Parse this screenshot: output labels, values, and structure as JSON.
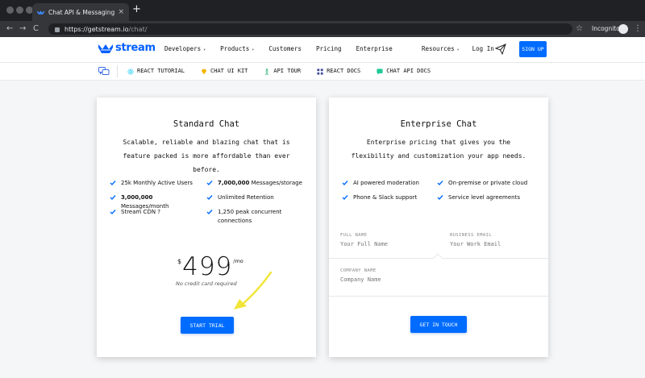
{
  "browser": {
    "tab_title": "Chat API & Messaging UI Kit",
    "tab_close": "×",
    "new_tab": "+",
    "url_host": "https://getstream.io",
    "url_path": "/chat/",
    "profile_label": "Incognito",
    "back": "←",
    "forward": "→",
    "reload": "C",
    "star": "☆",
    "menu": "⋮"
  },
  "header": {
    "logo_text": "stream",
    "nav": [
      {
        "label": "Developers",
        "caret": "▾"
      },
      {
        "label": "Products",
        "caret": "▾"
      },
      {
        "label": "Customers"
      },
      {
        "label": "Pricing"
      },
      {
        "label": "Enterprise"
      }
    ],
    "right_nav": [
      {
        "label": "Resources",
        "caret": "▾"
      },
      {
        "label": "Log In"
      }
    ],
    "signup_label": "SIGN UP",
    "brand_color": "#006cff"
  },
  "subnav": {
    "links": [
      {
        "label": "REACT TUTORIAL",
        "icon": "react-icon",
        "color": "#61dafb"
      },
      {
        "label": "CHAT UI KIT",
        "icon": "diamond-icon",
        "color": "#f5b400"
      },
      {
        "label": "API TOUR",
        "icon": "person-icon",
        "color": "#2bb673"
      },
      {
        "label": "REACT DOCS",
        "icon": "grid-icon",
        "color": "#3b4a9a"
      },
      {
        "label": "CHAT API DOCS",
        "icon": "chat-icon",
        "color": "#20c997"
      }
    ]
  },
  "standard": {
    "title": "Standard Chat",
    "description": "Scalable, reliable and blazing chat that is feature packed is more affordable than ever before.",
    "features_left": [
      {
        "bold": "",
        "text": "25k Monthly Active Users"
      },
      {
        "bold": "3,000,000",
        "text": " Messages/month"
      },
      {
        "bold": "",
        "text": "Stream CDN ?"
      }
    ],
    "features_right": [
      {
        "bold": "7,000,000",
        "text": " Messages/storage"
      },
      {
        "bold": "",
        "text": "Unlimited Retention"
      },
      {
        "bold": "",
        "text": "1,250 peak concurrent connections"
      }
    ],
    "currency": "$",
    "price": "499",
    "period": "/mo",
    "note": "No credit card required",
    "cta": "START TRIAL"
  },
  "enterprise": {
    "title": "Enterprise Chat",
    "description": "Enterprise pricing that gives you the flexibility and customization your app needs.",
    "features_left": [
      {
        "text": "AI powered moderation"
      },
      {
        "text": "Phone & Slack support"
      }
    ],
    "features_right": [
      {
        "text": "On-premise or private cloud"
      },
      {
        "text": "Service level agreements"
      }
    ],
    "form": {
      "full_name_label": "FULL NAME",
      "full_name_placeholder": "Your Full Name",
      "email_label": "BUSINESS EMAIL",
      "email_placeholder": "Your Work Email",
      "company_label": "COMPANY NAME",
      "company_placeholder": "Company Name"
    },
    "cta": "GET IN TOUCH"
  },
  "colors": {
    "check": "#006cff",
    "arrow": "#f2e53a"
  }
}
